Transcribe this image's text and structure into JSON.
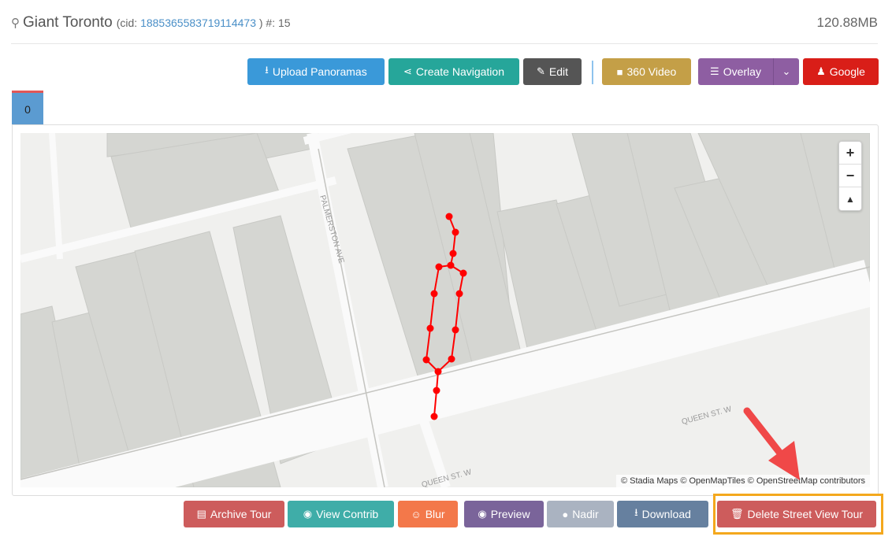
{
  "header": {
    "title": "Giant Toronto",
    "cid_prefix": "(cid:",
    "cid": "1885365583719114473",
    "cid_suffix": ") #: 15",
    "size": "120.88MB",
    "icon": "map-marker-icon"
  },
  "toolbar": {
    "upload": "Upload Panoramas",
    "navigation": "Create Navigation",
    "edit": "Edit",
    "video": "360 Video",
    "overlay": "Overlay",
    "google": "Google"
  },
  "tabs": [
    {
      "label": "0",
      "active": true
    }
  ],
  "map": {
    "zoom_in": "+",
    "zoom_out": "−",
    "reset": "▲",
    "attribution": "© Stadia Maps © OpenMapTiles © OpenStreetMap contributors",
    "streets": [
      "PALMERSTON AVE",
      "QUEEN ST. W",
      "QUEEN ST. W"
    ],
    "path_color": "#ff0000",
    "point_count": 15
  },
  "actions": {
    "archive": "Archive Tour",
    "contrib": "View Contrib",
    "blur": "Blur",
    "preview": "Preview",
    "nadir": "Nadir",
    "download": "Download",
    "delete": "Delete Street View Tour"
  },
  "colors": {
    "upload": "#3a99d9",
    "navigation": "#26a69a",
    "edit": "#555555",
    "video": "#c49f47",
    "overlay": "#8e5ea2",
    "google": "#d91e18",
    "archive": "#cd5c5c",
    "contrib": "#3fada8",
    "blur": "#f3784a",
    "preview": "#7a649a",
    "nadir": "#aab3c1",
    "download": "#66809f",
    "delete": "#cd5c5c",
    "highlight": "#f4a81d",
    "arrow": "#f04848"
  }
}
